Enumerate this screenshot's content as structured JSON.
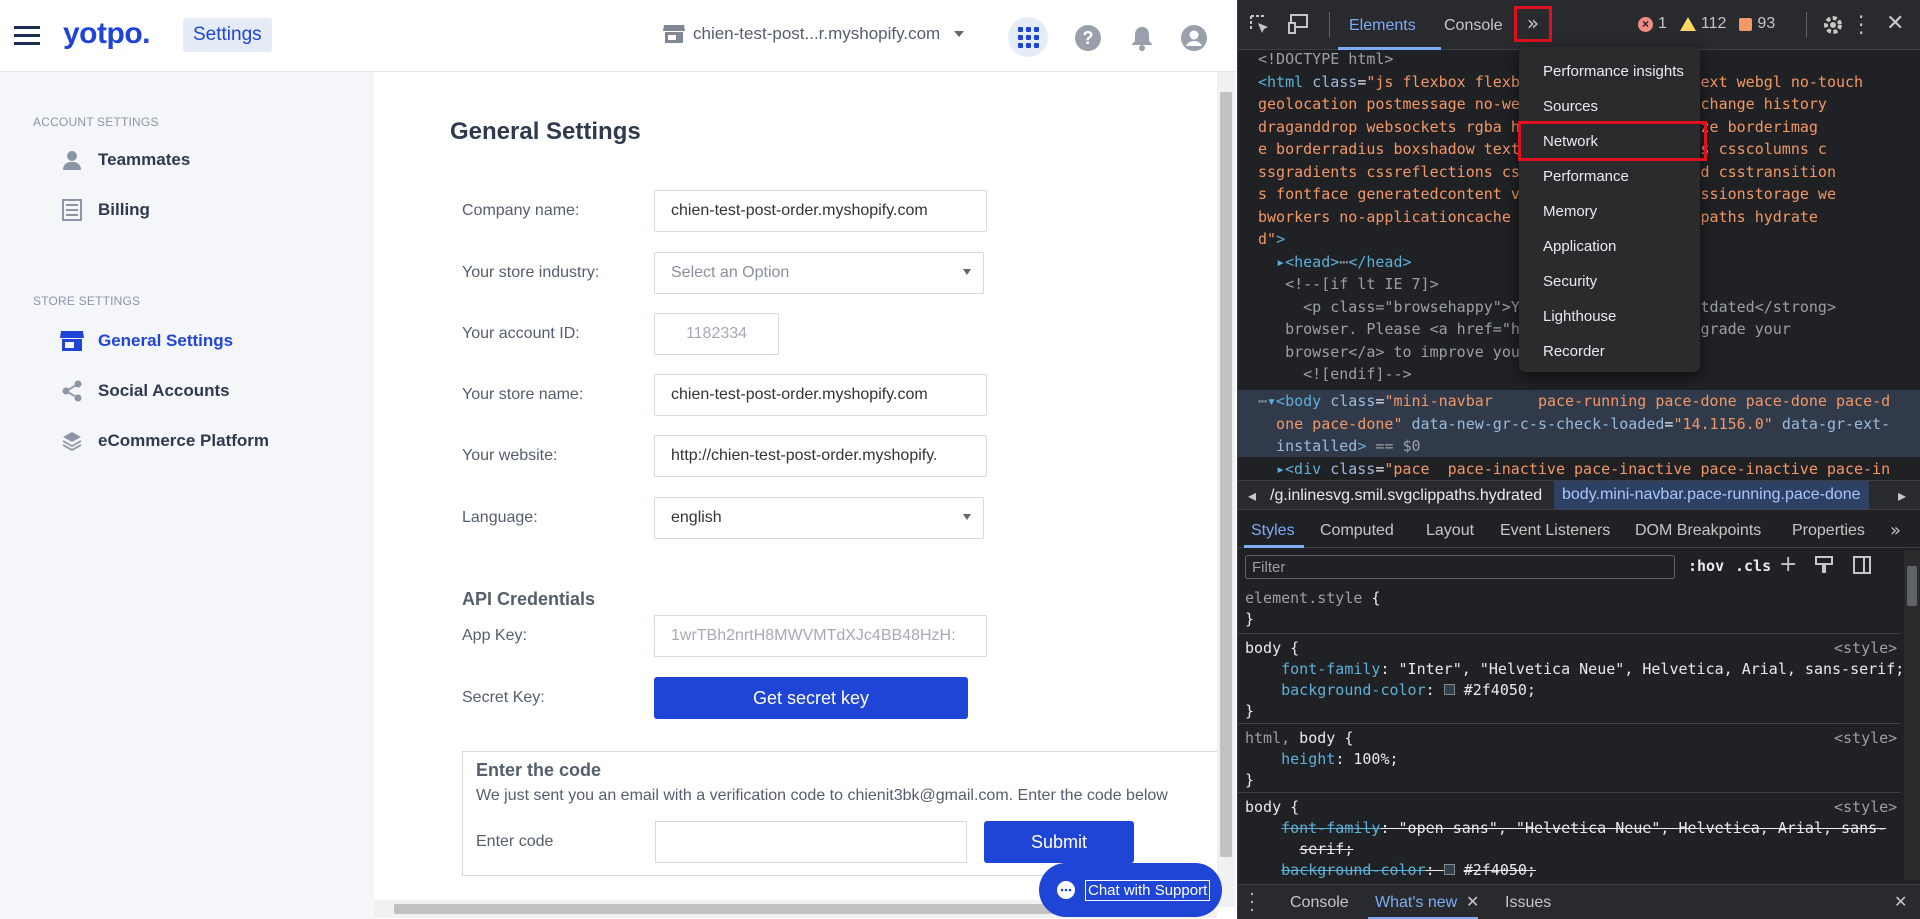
{
  "app": {
    "logo": "yotpo.",
    "section": "Settings",
    "store_name": "chien-test-post...r.myshopify.com"
  },
  "sidebar": {
    "account_heading": "ACCOUNT SETTINGS",
    "account_items": [
      {
        "label": "Teammates",
        "icon": "person-icon"
      },
      {
        "label": "Billing",
        "icon": "list-icon"
      }
    ],
    "store_heading": "STORE SETTINGS",
    "store_items": [
      {
        "label": "General Settings",
        "icon": "store-icon",
        "active": true
      },
      {
        "label": "Social Accounts",
        "icon": "share-icon"
      },
      {
        "label": "eCommerce Platform",
        "icon": "layers-icon"
      }
    ]
  },
  "main": {
    "title": "General Settings",
    "fields": {
      "company_name": {
        "label": "Company name:",
        "value": "chien-test-post-order.myshopify.com"
      },
      "industry": {
        "label": "Your store industry:",
        "placeholder": "Select an Option"
      },
      "account_id": {
        "label": "Your account ID:",
        "value": "1182334"
      },
      "store_name": {
        "label": "Your store name:",
        "value": "chien-test-post-order.myshopify.com"
      },
      "website": {
        "label": "Your website:",
        "value": "http://chien-test-post-order.myshopify."
      },
      "language": {
        "label": "Language:",
        "value": "english"
      }
    },
    "api": {
      "heading": "API Credentials",
      "app_key_label": "App Key:",
      "app_key_value": "1wrTBh2nrtH8MWVMTdXJc4BB48HzH:",
      "secret_label": "Secret Key:",
      "secret_button": "Get secret key"
    },
    "code_box": {
      "title": "Enter the code",
      "text": "We just sent you an email with a verification code to chienit3bk@gmail.com. Enter the code below",
      "input_label": "Enter code",
      "submit": "Submit"
    },
    "chat": "Chat with Support"
  },
  "devtools": {
    "tabs": [
      "Elements",
      "Console"
    ],
    "active_tab": "Elements",
    "counts": {
      "errors": "1",
      "warnings": "112",
      "issues": "93"
    },
    "more_menu": [
      "Performance insights",
      "Sources",
      "Network",
      "Performance",
      "Memory",
      "Application",
      "Security",
      "Lighthouse",
      "Recorder"
    ],
    "highlighted_menu_item": "Network",
    "breadcrumb": [
      "/g.inlinesvg.smil.svgclippaths.hydrated",
      "body.mini-navbar.pace-running.pace-done"
    ],
    "styles_tabs": [
      "Styles",
      "Computed",
      "Layout",
      "Event Listeners",
      "DOM Breakpoints",
      "Properties"
    ],
    "filter_placeholder": "Filter",
    "hov": ":hov",
    "cls": ".cls",
    "drawer_tabs": [
      "Console",
      "What's new",
      "Issues"
    ],
    "colors": {
      "bg": "#202124",
      "accent": "#7cacf8",
      "red_box": "#e0101e"
    }
  }
}
